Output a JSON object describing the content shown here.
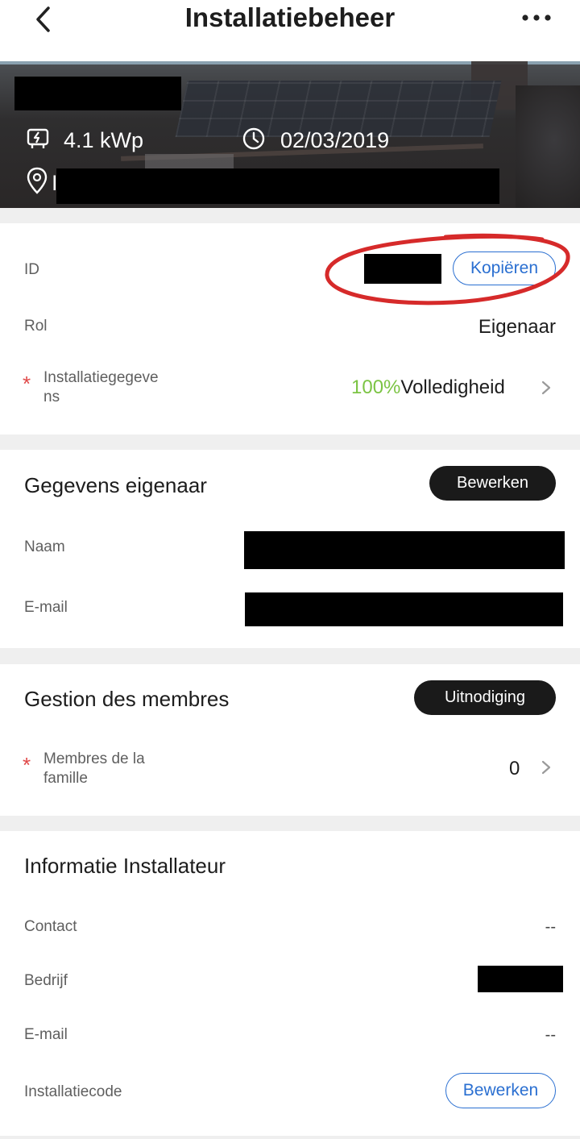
{
  "header": {
    "title": "Installatiebeheer",
    "back_icon": "chevron-left-icon",
    "more_icon": "more-horizontal-icon"
  },
  "banner": {
    "capacity": "4.1 kWp",
    "capacity_icon": "solar-inverter-icon",
    "date": "02/03/2019",
    "date_icon": "clock-icon",
    "location_icon": "location-pin-icon",
    "address_prefix": "I"
  },
  "info": {
    "id_label": "ID",
    "copy_button": "Kopiëren",
    "role_label": "Rol",
    "role_value": "Eigenaar",
    "install_label": "Installatiegegeve\nns",
    "completeness_pct": "100%",
    "completeness_label": "Volledigheid"
  },
  "owner": {
    "title": "Gegevens eigenaar",
    "edit_button": "Bewerken",
    "name_label": "Naam",
    "email_label": "E-mail"
  },
  "members": {
    "title": "Gestion des membres",
    "invite_button": "Uitnodiging",
    "family_label": "Membres de la\nfamille",
    "family_count": "0"
  },
  "installer": {
    "title": "Informatie Installateur",
    "contact_label": "Contact",
    "contact_value": "--",
    "company_label": "Bedrijf",
    "email_label": "E-mail",
    "email_value": "--",
    "code_label": "Installatiecode",
    "code_button": "Bewerken"
  },
  "colors": {
    "accent_blue": "#2a6fd1",
    "completeness_green": "#7cc444",
    "required_red": "#e04848",
    "highlight_circle": "#d62a2a"
  }
}
